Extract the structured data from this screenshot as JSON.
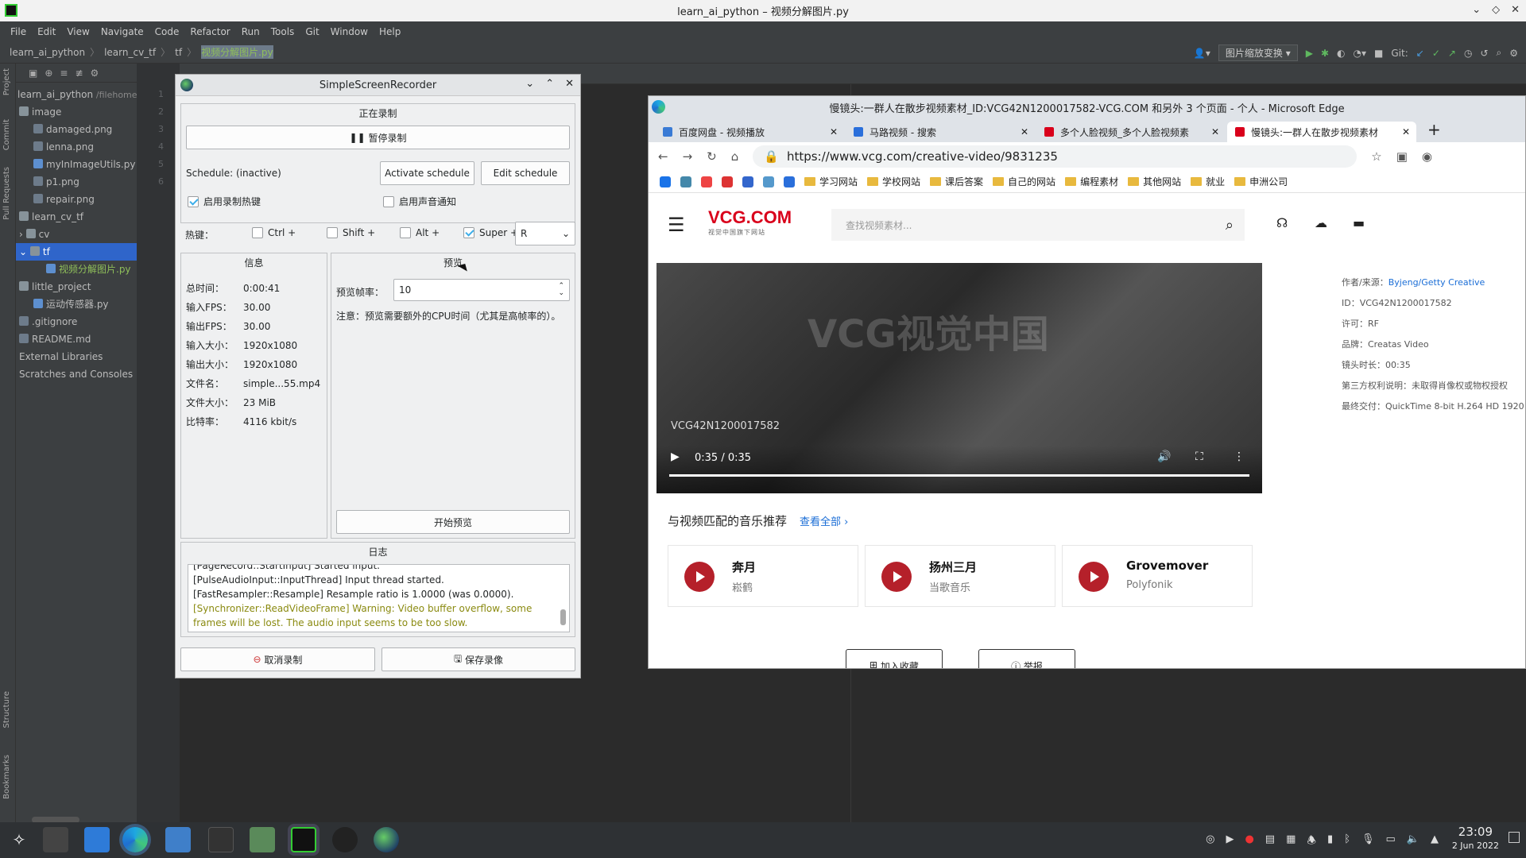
{
  "ide": {
    "title": "learn_ai_python – 视频分解图片.py",
    "menu": [
      "File",
      "Edit",
      "View",
      "Navigate",
      "Code",
      "Refactor",
      "Run",
      "Tools",
      "Git",
      "Window",
      "Help"
    ],
    "breadcrumb": [
      "learn_ai_python",
      "learn_cv_tf",
      "tf",
      "视频分解图片.py"
    ],
    "run_config": "图片缩放变换",
    "git_label": "Git:",
    "side_tabs": [
      "Project",
      "Commit",
      "Pull Requests",
      "Structure",
      "Bookmarks"
    ],
    "tree": [
      {
        "label": "learn_ai_python",
        "extra": "/filehome/",
        "type": "root"
      },
      {
        "label": "image",
        "type": "folder"
      },
      {
        "label": "damaged.png",
        "type": "file"
      },
      {
        "label": "lenna.png",
        "type": "file"
      },
      {
        "label": "myInImageUtils.py",
        "type": "py"
      },
      {
        "label": "p1.png",
        "type": "file"
      },
      {
        "label": "repair.png",
        "type": "file"
      },
      {
        "label": "learn_cv_tf",
        "type": "folder"
      },
      {
        "label": "cv",
        "type": "folder"
      },
      {
        "label": "tf",
        "type": "folder"
      },
      {
        "label": "视频分解图片.py",
        "type": "py"
      },
      {
        "label": "little_project",
        "type": "folder"
      },
      {
        "label": "运动传感器.py",
        "type": "py"
      },
      {
        "label": ".gitignore",
        "type": "file"
      },
      {
        "label": "README.md",
        "type": "file"
      },
      {
        "label": "External Libraries",
        "type": "lib"
      },
      {
        "label": "Scratches and Consoles",
        "type": "lib"
      }
    ],
    "line_numbers": [
      "1",
      "2",
      "3",
      "4",
      "5",
      "6"
    ],
    "tab_label": "视频分解图片.py"
  },
  "ssr": {
    "title": "SimpleScreenRecorder",
    "recording_header": "正在录制",
    "pause_button": "暂停录制",
    "schedule_status": "Schedule: (inactive)",
    "activate_schedule": "Activate schedule",
    "edit_schedule": "Edit schedule",
    "enable_hotkey": "启用录制热键",
    "enable_sound": "启用声音通知",
    "hotkey_label": "热键：",
    "mods": [
      "Ctrl +",
      "Shift +",
      "Alt +",
      "Super +"
    ],
    "key_value": "R",
    "info_header": "信息",
    "info_rows": [
      {
        "k": "总时间：",
        "v": "0:00:41"
      },
      {
        "k": "输入FPS：",
        "v": "30.00"
      },
      {
        "k": "输出FPS：",
        "v": "30.00"
      },
      {
        "k": "输入大小：",
        "v": "1920x1080"
      },
      {
        "k": "输出大小：",
        "v": "1920x1080"
      },
      {
        "k": "文件名：",
        "v": "simple...55.mp4"
      },
      {
        "k": "文件大小：",
        "v": "23 MiB"
      },
      {
        "k": "比特率：",
        "v": "4116 kbit/s"
      }
    ],
    "preview_header": "预览",
    "preview_rate_label": "预览帧率：",
    "preview_rate_value": "10",
    "preview_note": "注意：预览需要额外的CPU时间（尤其是高帧率的）。",
    "start_preview": "开始预览",
    "log_header": "日志",
    "log_lines": [
      "[PageRecord::StartInput] Started input.",
      "[PulseAudioInput::InputThread] Input thread started.",
      "[FastResampler::Resample] Resample ratio is 1.0000 (was 0.0000).",
      "[Synchronizer::ReadVideoFrame] Warning: Video buffer overflow, some frames will be lost. The audio input seems to be too slow."
    ],
    "cancel_button": "取消录制",
    "save_button": "保存录像"
  },
  "edge": {
    "title": "慢镜头:一群人在散步视频素材_ID:VCG42N1200017582-VCG.COM 和另外 3 个页面 - 个人 - Microsoft Edge",
    "tabs": [
      {
        "label": "百度网盘 - 视频播放",
        "color": "#3a7bd5"
      },
      {
        "label": "马路视频 - 搜索",
        "color": "#2a6fdb"
      },
      {
        "label": "多个人脸视频_多个人脸视频素",
        "color": "#d9001b"
      },
      {
        "label": "慢镜头:一群人在散步视频素材",
        "color": "#d9001b"
      }
    ],
    "url": "https://www.vcg.com/creative-video/9831235",
    "bookmarks": [
      "学习网站",
      "学校网站",
      "课后答案",
      "自己的网站",
      "编程素材",
      "其他网站",
      "就业",
      "申洲公司"
    ],
    "site_logo": "VCG.COM",
    "site_sub": "视觉中国旗下网站",
    "search_placeholder": "查找视频素材...",
    "video_watermark": "VCG视觉中国",
    "video_id_overlay": "VCG42N1200017582",
    "video_time": "0:35 / 0:35",
    "info": [
      {
        "k": "作者/来源：",
        "v": "Byjeng/Getty Creative",
        "link": true
      },
      {
        "k": "ID：",
        "v": "VCG42N1200017582"
      },
      {
        "k": "许可：",
        "v": "RF"
      },
      {
        "k": "品牌：",
        "v": "Creatas Video"
      },
      {
        "k": "镜头时长：",
        "v": "00:35"
      },
      {
        "k": "第三方权利说明：",
        "v": "未取得肖像权或物权授权"
      },
      {
        "k": "最终交付：",
        "v": "QuickTime 8-bit H.264 HD 1920"
      }
    ],
    "music_title": "与视频匹配的音乐推荐",
    "music_more": "查看全部 ›",
    "music": [
      {
        "title": "奔月",
        "artist": "崧鹤"
      },
      {
        "title": "扬州三月",
        "artist": "当歌音乐"
      },
      {
        "title": "Grovemover",
        "artist": "Polyfonik"
      }
    ],
    "actions": [
      "加入收藏",
      "举报"
    ]
  },
  "taskbar": {
    "time": "23:09",
    "date": "2 Jun 2022"
  }
}
